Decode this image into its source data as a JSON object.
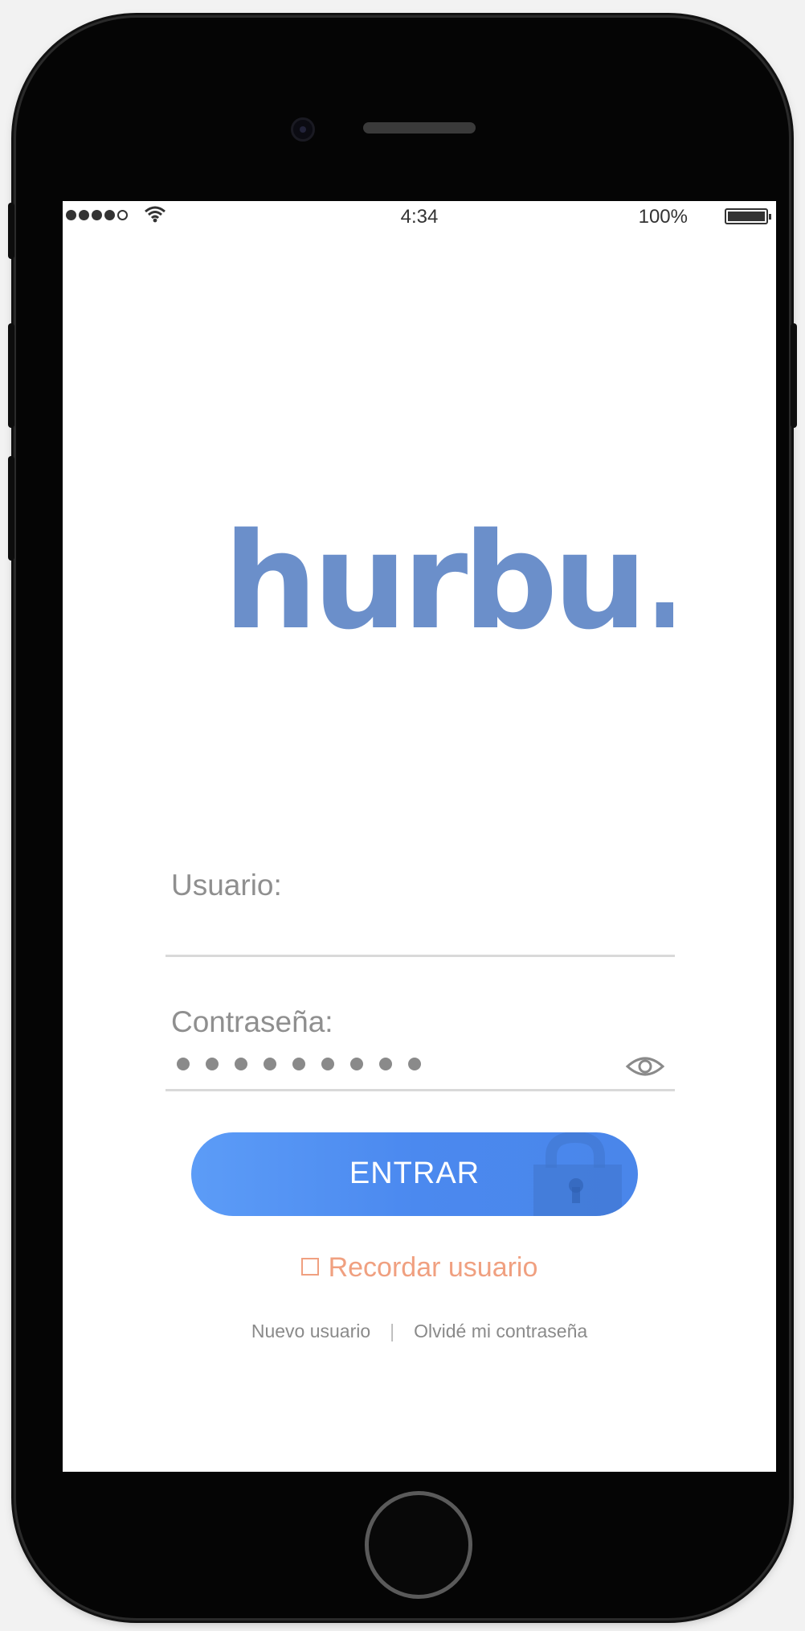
{
  "status_bar": {
    "time": "4:34",
    "battery": "100%",
    "signal_icon": "signal-dots-icon",
    "wifi_icon": "wifi-icon",
    "battery_icon": "battery-icon"
  },
  "brand": {
    "logo_text": "hurbu.",
    "color": "#6b8fca"
  },
  "form": {
    "username_label": "Usuario:",
    "username_value": "",
    "password_label": "Contraseña:",
    "password_mask_count": 9,
    "show_password_icon": "eye-icon"
  },
  "actions": {
    "login_label": "ENTRAR",
    "login_color": "#4a8cf0",
    "lock_icon": "lock-icon",
    "remember_label": "Recordar usuario",
    "remember_color": "#f0a080",
    "new_user_label": "Nuevo usuario",
    "separator": "|",
    "forgot_password_label": "Olvidé mi contraseña"
  }
}
